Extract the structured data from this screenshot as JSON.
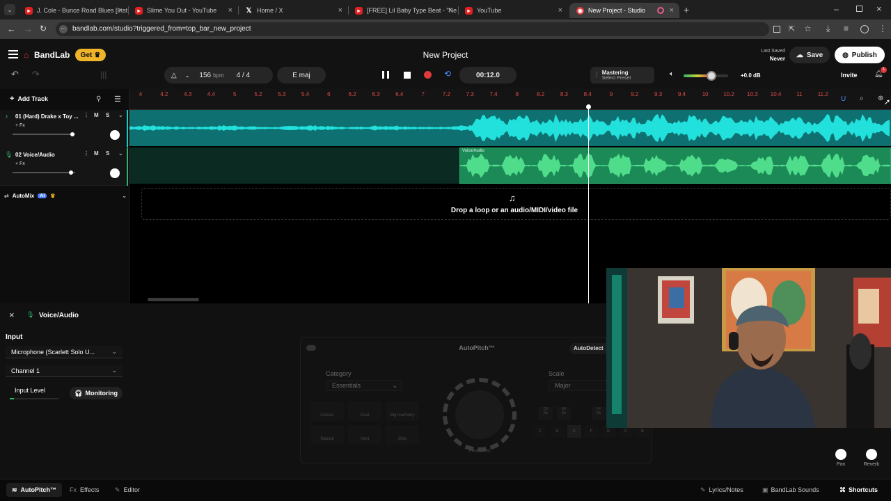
{
  "browser": {
    "tabs": [
      {
        "title": "J. Cole - Bunce Road Blues [Inst",
        "icon": "youtube-icon"
      },
      {
        "title": "Slime You Out - YouTube",
        "icon": "youtube-icon"
      },
      {
        "title": "Home / X",
        "icon": "x-icon"
      },
      {
        "title": "[FREE] Lil Baby Type Beat - \"Ne",
        "icon": "youtube-icon"
      },
      {
        "title": "YouTube",
        "icon": "youtube-icon"
      },
      {
        "title": "New Project - Studio",
        "icon": "bandlab-icon"
      }
    ],
    "url": "bandlab.com/studio?triggered_from=top_bar_new_project"
  },
  "header": {
    "brand": "BandLab",
    "get_label": "Get",
    "project_title": "New Project",
    "last_saved_label": "Last Saved",
    "last_saved_value": "Never",
    "save_label": "Save",
    "publish_label": "Publish",
    "invite_label": "Invite",
    "notification_count": "1"
  },
  "transport": {
    "tempo": "156",
    "tempo_unit": "bpm",
    "time_signature": "4 / 4",
    "key": "E maj",
    "time": "00:12.0",
    "mastering_label": "Mastering",
    "mastering_preset": "Select Preset",
    "volume_db": "+0.0 dB",
    "volume_level": 0.63
  },
  "ruler": {
    "ticks": [
      "4",
      "4.2",
      "4.3",
      "4.4",
      "5",
      "5.2",
      "5.3",
      "5.4",
      "6",
      "6.2",
      "6.3",
      "6.4",
      "7",
      "7.2",
      "7.3",
      "7.4",
      "8",
      "8.2",
      "8.3",
      "8.4",
      "9",
      "9.2",
      "9.3",
      "9.4",
      "10",
      "10.2",
      "10.3",
      "10.4",
      "11",
      "11.2"
    ]
  },
  "tracks": [
    {
      "name": "01 (Hard) Drake x Toy ...",
      "fx": "+ Fx",
      "mute": "M",
      "solo": "S",
      "volume": 0.95
    },
    {
      "name": "02 Voice/Audio",
      "fx": "+ Fx",
      "mute": "M",
      "solo": "S",
      "volume": 0.93
    }
  ],
  "add_track_label": "Add Track",
  "automix": {
    "label": "AutoMix",
    "badge": "AI"
  },
  "clip_label": "Voice/Audio",
  "drop_text": "Drop a loop or an audio/MIDI/video file",
  "panel": {
    "title": "Voice/Audio",
    "input_heading": "Input",
    "input_device": "Microphone (Scarlett Solo U...",
    "channel": "Channel 1",
    "input_level_label": "Input Level",
    "monitoring_label": "Monitoring",
    "autopitch_title": "AutoPitch™",
    "autodetect_label": "AutoDetect",
    "category_label": "Category",
    "category_value": "Essentials",
    "scale_label": "Scale",
    "scale_value": "Major",
    "knob_label": "Heaviest",
    "presets": [
      "Classic",
      "Duet",
      "Big Harmony",
      "Natural",
      "Hard",
      "Chip"
    ],
    "notes_top": [
      "C#\nDb",
      "D#\nEb",
      "F#\nGb"
    ],
    "notes_bottom": [
      "C",
      "D",
      "E",
      "F",
      "G",
      "A",
      "B"
    ],
    "pan_label": "Pan",
    "reverb_label": "Reverb"
  },
  "footer": {
    "tabs": [
      "AutoPitch™",
      "Effects",
      "Editor"
    ],
    "right": [
      "Lyrics/Notes",
      "BandLab Sounds",
      "Shortcuts"
    ]
  },
  "colors": {
    "accent": "#e0393e",
    "teal": "#1ec9c6",
    "green": "#2fb36b",
    "gold": "#f0b429"
  }
}
